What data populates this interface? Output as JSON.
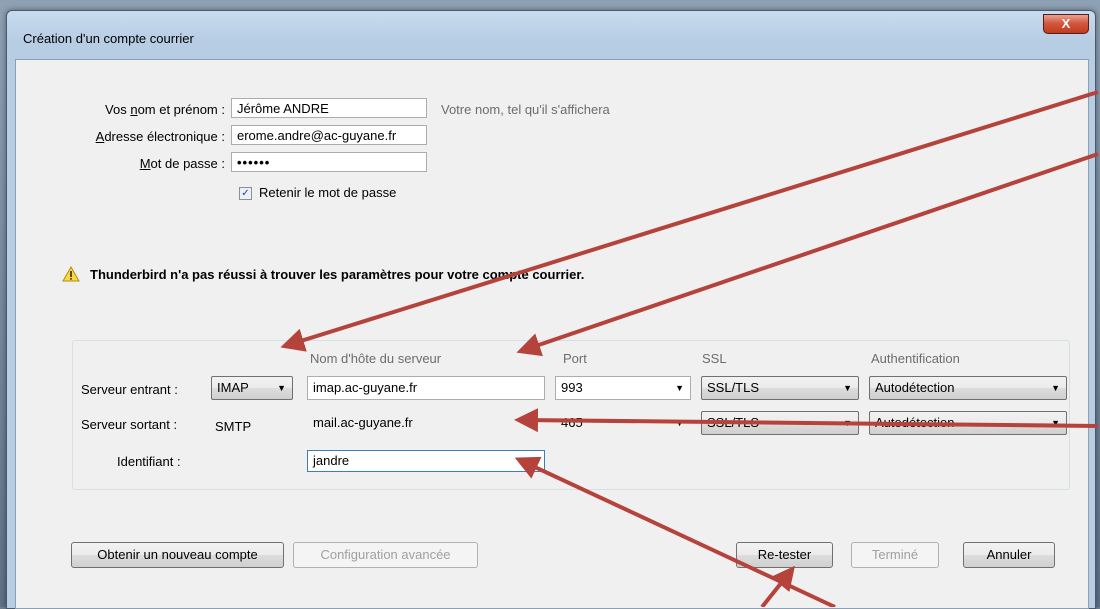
{
  "window": {
    "title": "Création d'un compte courrier",
    "close_label": "X"
  },
  "identity": {
    "name_label_pre": "Vos ",
    "name_label_u": "n",
    "name_label_post": "om et prénom :",
    "name_value": "Jérôme ANDRE",
    "name_hint": "Votre nom, tel qu'il s'affichera",
    "email_label_u": "A",
    "email_label_post": "dresse électronique :",
    "email_value": "erome.andre@ac-guyane.fr",
    "password_label_u": "M",
    "password_label_post": "ot de passe :",
    "password_value": "••••••",
    "remember_label": "Retenir le mot de passe",
    "remember_checked": true
  },
  "warning": {
    "text": "Thunderbird n'a pas réussi à trouver les paramètres pour votre compte courrier."
  },
  "servers": {
    "headers": {
      "hostname": "Nom d'hôte du serveur",
      "port": "Port",
      "ssl": "SSL",
      "auth": "Authentification"
    },
    "incoming": {
      "label": "Serveur entrant :",
      "protocol": "IMAP",
      "host": "imap.ac-guyane.fr",
      "port": "993",
      "ssl": "SSL/TLS",
      "auth": "Autodétection"
    },
    "outgoing": {
      "label": "Serveur sortant :",
      "protocol": "SMTP",
      "host": "mail.ac-guyane.fr",
      "port": "465",
      "ssl": "SSL/TLS",
      "auth": "Autodétection"
    },
    "username": {
      "label": "Identifiant :",
      "value": "jandre"
    }
  },
  "buttons": {
    "new_account": "Obtenir un nouveau compte",
    "advanced": "Configuration avancée",
    "retest": "Re-tester",
    "done": "Terminé",
    "cancel": "Annuler"
  },
  "colors": {
    "annotation_arrow": "#b5433b",
    "window_frame": "#b7cde4",
    "dialog_bg": "#f0f0f0"
  }
}
